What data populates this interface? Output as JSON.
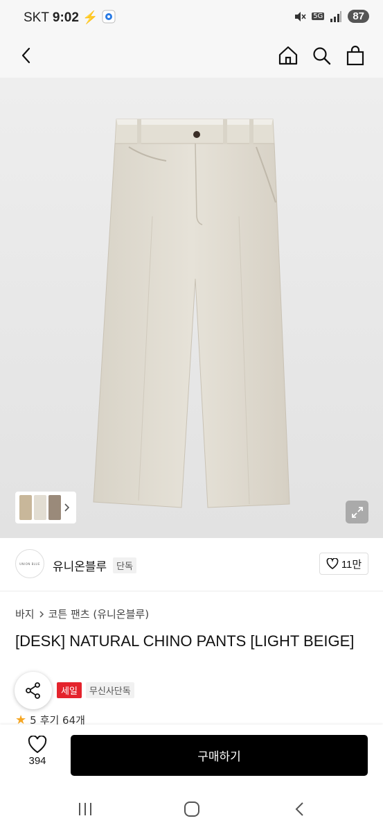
{
  "status_bar": {
    "carrier": "SKT",
    "time": "9:02",
    "network": "5G",
    "battery": "87"
  },
  "header": {
    "back_icon": "chevron-left-icon",
    "home_icon": "home-icon",
    "search_icon": "search-icon",
    "cart_icon": "shopping-bag-icon"
  },
  "product_image": {
    "alt": "light beige chino pants",
    "colors": [
      "#e2ddd2",
      "#c8b79a",
      "#9a8a7a",
      "#d9cdb6"
    ]
  },
  "brand": {
    "logo_text": "UNION BLUE",
    "name": "유니온블루",
    "exclusive_badge": "단독",
    "likes": "11만"
  },
  "breadcrumb": {
    "category": "바지",
    "subcategory": "코튼 팬츠 (유니온블루)"
  },
  "product": {
    "title": "[DESK] NATURAL CHINO PANTS [LIGHT BEIGE]",
    "sale_badge": "세일",
    "musinsa_badge": "무신사단독",
    "rating": "5",
    "reviews": "후기 64개"
  },
  "bottom_bar": {
    "favorite_count": "394",
    "buy_label": "구매하기"
  },
  "accent_colors": {
    "sale_red": "#e4232c",
    "star": "#f5a623",
    "buy_black": "#000000"
  }
}
